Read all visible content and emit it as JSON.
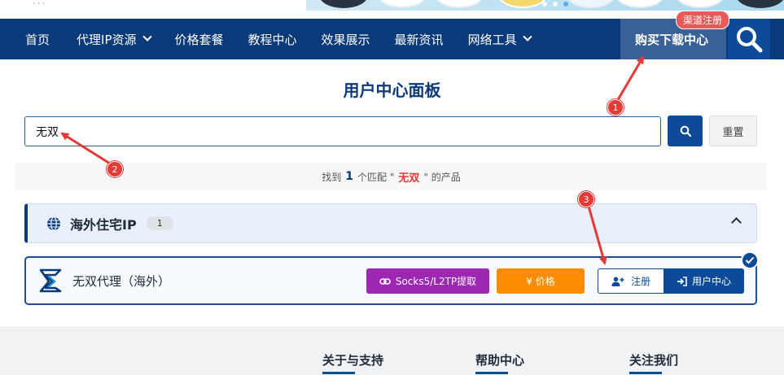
{
  "header": {
    "site_text": "...",
    "nav": {
      "home": "首页",
      "proxy_resources": "代理IP资源",
      "pricing": "价格套餐",
      "tutorials": "教程中心",
      "showcase": "效果展示",
      "news": "最新资讯",
      "tools": "网络工具",
      "buy_download": "购买下载中心",
      "channel_badge": "渠道注册"
    }
  },
  "page": {
    "title": "用户中心面板"
  },
  "search": {
    "value": "无双",
    "reset_label": "重置"
  },
  "result": {
    "prefix": "找到",
    "count": "1",
    "middle": "个匹配 \"",
    "keyword": "无双",
    "suffix": "\" 的产品"
  },
  "category": {
    "title": "海外住宅IP",
    "count": "1"
  },
  "product": {
    "name": "无双代理（海外）",
    "socks_label": "Socks5/L2TP提取",
    "price_label": "¥ 价格",
    "register_label": "注册",
    "user_center_label": "用户中心"
  },
  "footer": {
    "col1": "关于与支持",
    "col2": "帮助中心",
    "col3": "关注我们"
  },
  "annotations": [
    "1",
    "2",
    "3"
  ],
  "colors": {
    "nav_bg": "#0b3a7a",
    "primary": "#0d4b98",
    "annotation_red": "#e53935",
    "socks_purple": "#9c27b0",
    "price_orange": "#fb8c00"
  }
}
